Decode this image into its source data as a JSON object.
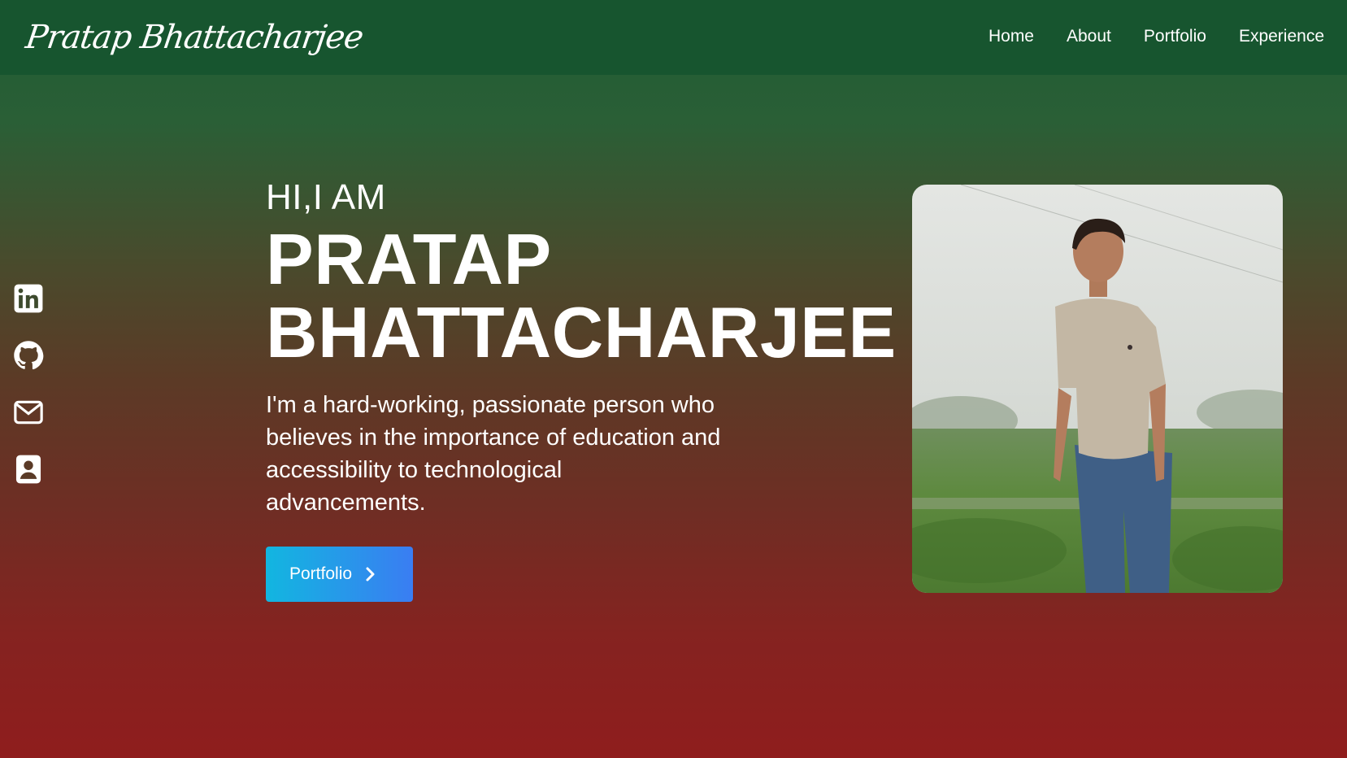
{
  "header": {
    "brand": "Pratap Bhattacharjee",
    "nav": [
      "Home",
      "About",
      "Portfolio",
      "Experience"
    ]
  },
  "socials": [
    {
      "icon": "linkedin-icon"
    },
    {
      "icon": "github-icon"
    },
    {
      "icon": "mail-icon"
    },
    {
      "icon": "contact-card-icon"
    }
  ],
  "hero": {
    "greeting": "HI,I AM",
    "name_line1": "PRATAP",
    "name_line2": "BHATTACHARJEE",
    "bio": "I'm a hard-working, passionate person who believes in the importance of education and accessibility to technological advancements.",
    "cta_label": "Portfolio",
    "cta_icon": "chevron-right-icon"
  },
  "colors": {
    "navbar": "#17552f",
    "gradient_top": "#2a5f36",
    "gradient_bottom": "#8f1d1d",
    "button_start": "#12b6e0",
    "button_end": "#3a7df2"
  }
}
